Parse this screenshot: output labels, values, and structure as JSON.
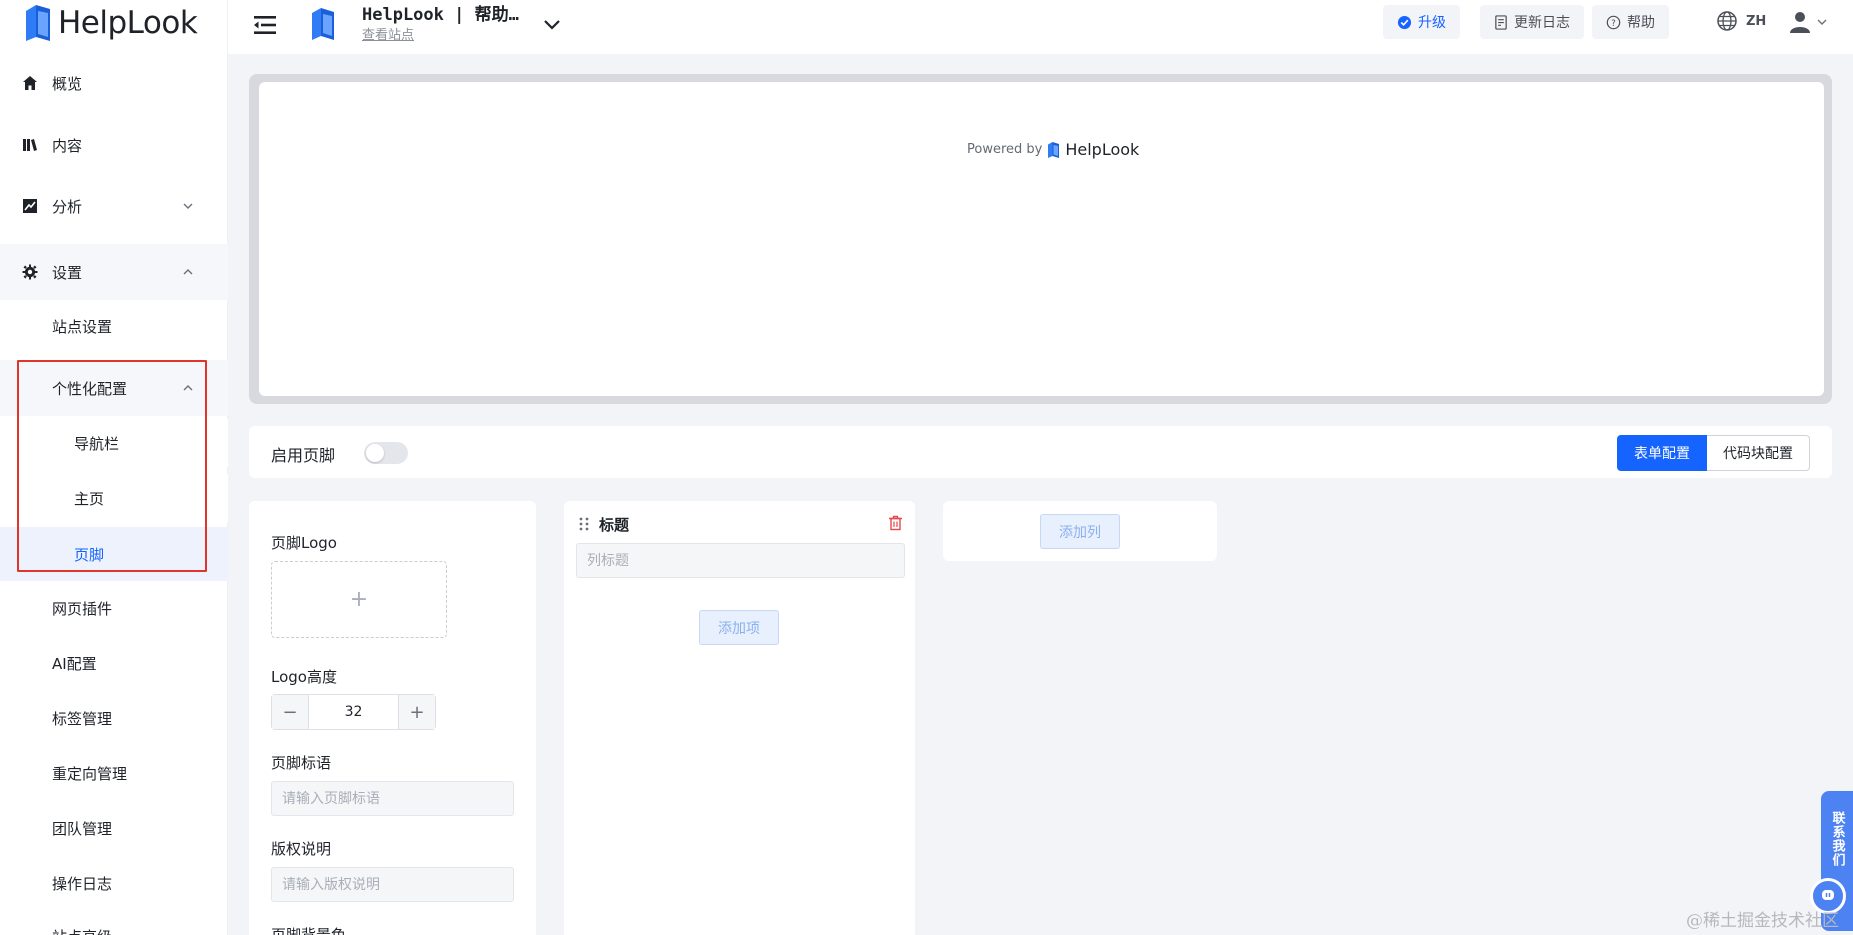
{
  "brand": {
    "logo_text": "HelpLook"
  },
  "sidebar": {
    "items": [
      {
        "label": "概览"
      },
      {
        "label": "内容"
      },
      {
        "label": "分析"
      },
      {
        "label": "设置"
      }
    ],
    "settings_sub": [
      {
        "label": "站点设置"
      },
      {
        "label": "个性化配置"
      },
      {
        "label": "导航栏"
      },
      {
        "label": "主页"
      },
      {
        "label": "页脚"
      },
      {
        "label": "网页插件"
      },
      {
        "label": "AI配置"
      },
      {
        "label": "标签管理"
      },
      {
        "label": "重定向管理"
      },
      {
        "label": "团队管理"
      },
      {
        "label": "操作日志"
      },
      {
        "label": "站点高级"
      }
    ]
  },
  "topbar": {
    "site_title": "HelpLook | 帮助…",
    "site_link": "查看站点",
    "upgrade": "升级",
    "changelog": "更新日志",
    "help": "帮助",
    "lang": "ZH"
  },
  "preview": {
    "powered_by": "Powered by",
    "brand": "HelpLook"
  },
  "footer_bar": {
    "enable_label": "启用页脚",
    "tab_form": "表单配置",
    "tab_code": "代码块配置"
  },
  "form": {
    "logo_label": "页脚Logo",
    "logo_height_label": "Logo高度",
    "logo_height_value": "32",
    "slogan_label": "页脚标语",
    "slogan_placeholder": "请输入页脚标语",
    "copyright_label": "版权说明",
    "copyright_placeholder": "请输入版权说明",
    "bg_label": "页脚背景色"
  },
  "column": {
    "title": "标题",
    "title_placeholder": "列标题",
    "add_item": "添加项"
  },
  "add_column": "添加列",
  "contact": {
    "label": "联系我们"
  },
  "watermark": "@稀土掘金技术社区",
  "colors": {
    "accent": "#1664ff",
    "highlight": "#e0352b"
  }
}
